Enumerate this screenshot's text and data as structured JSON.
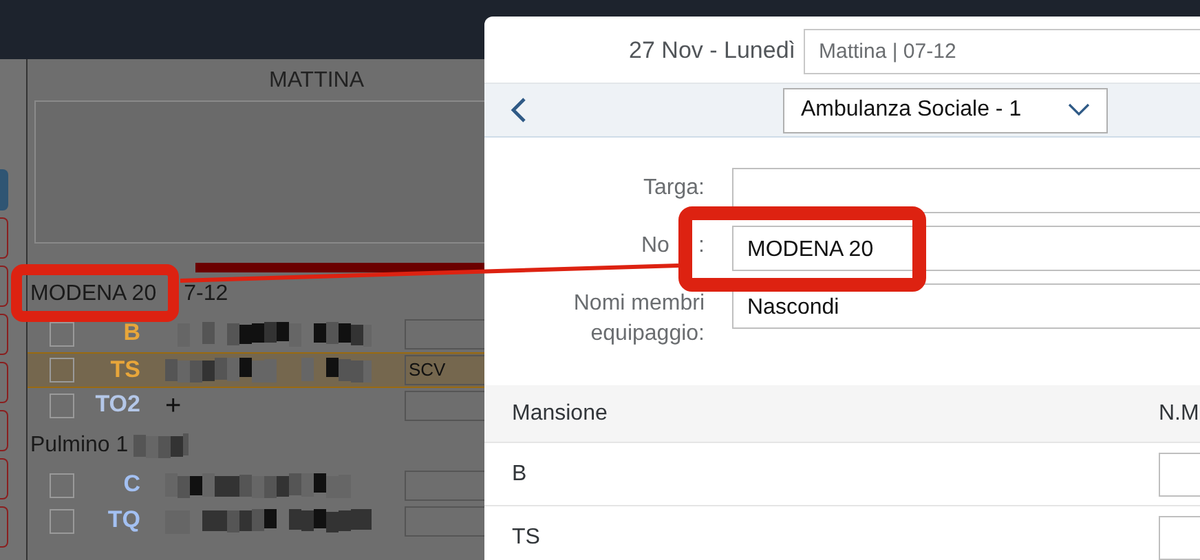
{
  "background_view": {
    "side_tabs": [
      {
        "selected": true
      },
      {
        "selected": false
      },
      {
        "selected": false
      },
      {
        "selected": false
      },
      {
        "selected": false
      },
      {
        "selected": false
      },
      {
        "selected": false
      },
      {
        "selected": false
      }
    ],
    "column_title": "MATTINA",
    "vehicles": [
      {
        "name": "MODENA 20",
        "time": "7-12",
        "time_pixelated": false,
        "rows": [
          {
            "role": "B",
            "color": "#e8a63a",
            "kind": "pixelated",
            "checked": false,
            "highlighted": false
          },
          {
            "role": "TS",
            "color": "#e8a63a",
            "kind": "pixelated",
            "checked": false,
            "highlighted": true,
            "note": "SCV"
          },
          {
            "role": "TO2",
            "color": "#b4c7e8",
            "kind": "add",
            "add_label": "+",
            "checked": false,
            "highlighted": false
          }
        ]
      },
      {
        "name": "Pulmino 1",
        "time_pixelated": true,
        "rows": [
          {
            "role": "C",
            "color": "#a3c0f2",
            "kind": "pixelated",
            "checked": false,
            "highlighted": false
          },
          {
            "role": "TQ",
            "color": "#a3c0f2",
            "kind": "pixelated",
            "checked": false,
            "highlighted": false
          }
        ]
      }
    ]
  },
  "dialog": {
    "date": "27 Nov - Lunedì",
    "shift_select": {
      "value": "Mattina | 07-12"
    },
    "vehicle_select": {
      "value": "Ambulanza Sociale - 1"
    },
    "form": [
      {
        "label": "Targa:"
      },
      {
        "label": "No",
        "label_end": ":",
        "value": "MODENA 20"
      },
      {
        "label": "Nomi membri equipaggio:",
        "value": "Nascondi"
      }
    ],
    "table": {
      "columns": [
        "Mansione",
        "N.M"
      ],
      "rows": [
        {
          "role": "B"
        },
        {
          "role": "TS"
        }
      ]
    }
  }
}
